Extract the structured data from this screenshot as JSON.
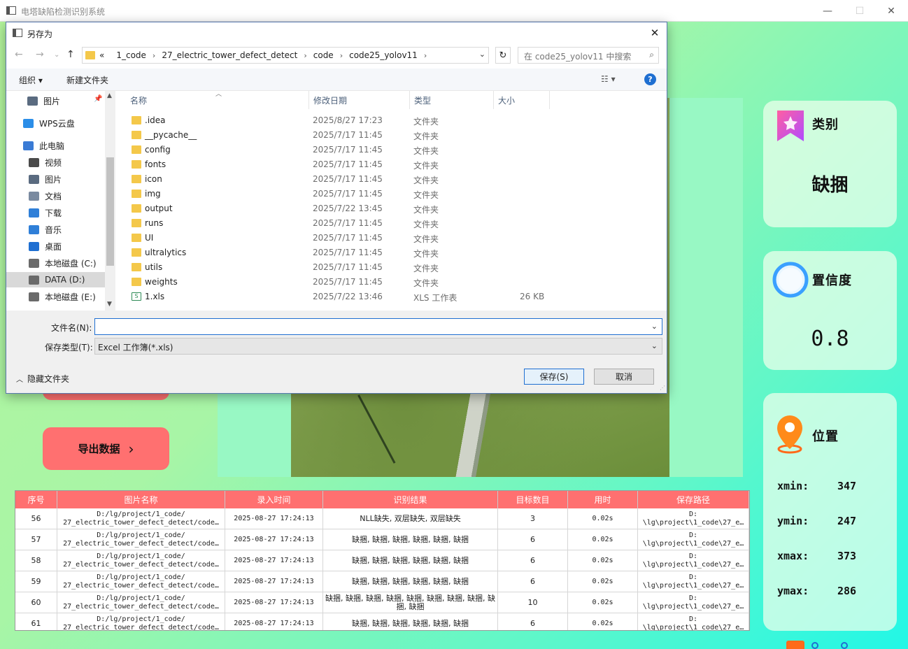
{
  "app": {
    "title": "电塔缺陷检测识别系统",
    "minimize": "—",
    "maximize": "☐",
    "close": "✕"
  },
  "left_buttons": {
    "export_label": "导出数据",
    "export_chevron": "›"
  },
  "info_cards": {
    "category": {
      "title": "类别",
      "value": "缺捆"
    },
    "confidence": {
      "title": "置信度",
      "value": "0.8"
    },
    "location": {
      "title": "位置",
      "xmin_label": "xmin:",
      "xmin": "347",
      "ymin_label": "ymin:",
      "ymin": "247",
      "xmax_label": "xmax:",
      "xmax": "373",
      "ymax_label": "ymax:",
      "ymax": "286"
    }
  },
  "table": {
    "headers": [
      "序号",
      "图片名称",
      "录入时间",
      "识别结果",
      "目标数目",
      "用时",
      "保存路径"
    ],
    "rows": [
      {
        "id": "56",
        "name1": "D:/lg/project/1_code/",
        "name2": "27_electric_tower_defect_detect/code…",
        "time": "2025-08-27 17:24:13",
        "result": "NLL缺失, 双层缺失, 双层缺失",
        "count": "3",
        "elapsed": "0.02s",
        "path1": "D:",
        "path2": "\\lg\\project\\1_code\\27_e…"
      },
      {
        "id": "57",
        "name1": "D:/lg/project/1_code/",
        "name2": "27_electric_tower_defect_detect/code…",
        "time": "2025-08-27 17:24:13",
        "result": "缺捆, 缺捆, 缺捆, 缺捆, 缺捆, 缺捆",
        "count": "6",
        "elapsed": "0.02s",
        "path1": "D:",
        "path2": "\\lg\\project\\1_code\\27_e…"
      },
      {
        "id": "58",
        "name1": "D:/lg/project/1_code/",
        "name2": "27_electric_tower_defect_detect/code…",
        "time": "2025-08-27 17:24:13",
        "result": "缺捆, 缺捆, 缺捆, 缺捆, 缺捆, 缺捆",
        "count": "6",
        "elapsed": "0.02s",
        "path1": "D:",
        "path2": "\\lg\\project\\1_code\\27_e…"
      },
      {
        "id": "59",
        "name1": "D:/lg/project/1_code/",
        "name2": "27_electric_tower_defect_detect/code…",
        "time": "2025-08-27 17:24:13",
        "result": "缺捆, 缺捆, 缺捆, 缺捆, 缺捆, 缺捆",
        "count": "6",
        "elapsed": "0.02s",
        "path1": "D:",
        "path2": "\\lg\\project\\1_code\\27_e…"
      },
      {
        "id": "60",
        "name1": "D:/lg/project/1_code/",
        "name2": "27_electric_tower_defect_detect/code…",
        "time": "2025-08-27 17:24:13",
        "result": "缺捆, 缺捆, 缺捆, 缺捆, 缺捆, 缺捆, 缺捆, 缺捆, 缺捆, 缺捆",
        "count": "10",
        "elapsed": "0.02s",
        "path1": "D:",
        "path2": "\\lg\\project\\1_code\\27_e…"
      },
      {
        "id": "61",
        "name1": "D:/lg/project/1_code/",
        "name2": "27_electric_tower_defect_detect/code…",
        "time": "2025-08-27 17:24:13",
        "result": "缺捆, 缺捆, 缺捆, 缺捆, 缺捆, 缺捆",
        "count": "6",
        "elapsed": "0.02s",
        "path1": "D:",
        "path2": "\\lg\\project\\1_code\\27_e…"
      }
    ]
  },
  "dialog": {
    "title": "另存为",
    "close": "✕",
    "breadcrumb": [
      "«",
      "1_code",
      "27_electric_tower_defect_detect",
      "code",
      "code25_yolov11"
    ],
    "search_placeholder": "在 code25_yolov11 中搜索",
    "toolbar": {
      "organize": "组织 ▾",
      "new_folder": "新建文件夹",
      "view": "☷ ▾",
      "help": "?"
    },
    "nav": [
      {
        "label": "图片",
        "icon": "picture-icon"
      },
      {
        "label": "WPS云盘",
        "icon": "cloud-icon"
      },
      {
        "label": "此电脑",
        "icon": "computer-icon"
      },
      {
        "label": "视频",
        "icon": "video-icon"
      },
      {
        "label": "图片",
        "icon": "picture-icon"
      },
      {
        "label": "文档",
        "icon": "document-icon"
      },
      {
        "label": "下载",
        "icon": "download-icon"
      },
      {
        "label": "音乐",
        "icon": "music-icon"
      },
      {
        "label": "桌面",
        "icon": "desktop-icon"
      },
      {
        "label": "本地磁盘 (C:)",
        "icon": "drive-icon"
      },
      {
        "label": "DATA (D:)",
        "icon": "drive-icon"
      },
      {
        "label": "本地磁盘 (E:)",
        "icon": "drive-icon"
      }
    ],
    "columns": {
      "name": "名称",
      "date": "修改日期",
      "type": "类型",
      "size": "大小"
    },
    "files": [
      {
        "name": ".idea",
        "date": "2025/8/27 17:23",
        "type": "文件夹",
        "size": ""
      },
      {
        "name": "__pycache__",
        "date": "2025/7/17 11:45",
        "type": "文件夹",
        "size": ""
      },
      {
        "name": "config",
        "date": "2025/7/17 11:45",
        "type": "文件夹",
        "size": ""
      },
      {
        "name": "fonts",
        "date": "2025/7/17 11:45",
        "type": "文件夹",
        "size": ""
      },
      {
        "name": "icon",
        "date": "2025/7/17 11:45",
        "type": "文件夹",
        "size": ""
      },
      {
        "name": "img",
        "date": "2025/7/17 11:45",
        "type": "文件夹",
        "size": ""
      },
      {
        "name": "output",
        "date": "2025/7/22 13:45",
        "type": "文件夹",
        "size": ""
      },
      {
        "name": "runs",
        "date": "2025/7/17 11:45",
        "type": "文件夹",
        "size": ""
      },
      {
        "name": "UI",
        "date": "2025/7/17 11:45",
        "type": "文件夹",
        "size": ""
      },
      {
        "name": "ultralytics",
        "date": "2025/7/17 11:45",
        "type": "文件夹",
        "size": ""
      },
      {
        "name": "utils",
        "date": "2025/7/17 11:45",
        "type": "文件夹",
        "size": ""
      },
      {
        "name": "weights",
        "date": "2025/7/17 11:45",
        "type": "文件夹",
        "size": ""
      },
      {
        "name": "1.xls",
        "date": "2025/7/22 13:46",
        "type": "XLS 工作表",
        "size": "26 KB"
      }
    ],
    "filename_label": "文件名(N):",
    "filename_value": "",
    "filetype_label": "保存类型(T):",
    "filetype_value": "Excel 工作簿(*.xls)",
    "hide_folders": "隐藏文件夹",
    "save_button": "保存(S)",
    "cancel_button": "取消"
  },
  "colors": {
    "accent_red": "#ff7070",
    "dialog_blue": "#1f6fd1"
  }
}
